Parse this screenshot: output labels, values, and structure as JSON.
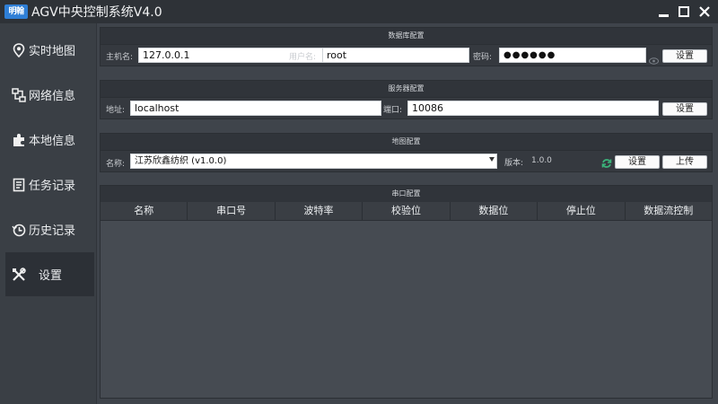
{
  "window": {
    "logo_text": "明翰",
    "title": "AGV中央控制系统V4.0"
  },
  "sidebar": {
    "items": [
      {
        "label": "实时地图",
        "icon": "map-pin-icon"
      },
      {
        "label": "网络信息",
        "icon": "network-icon"
      },
      {
        "label": "本地信息",
        "icon": "puzzle-icon"
      },
      {
        "label": "任务记录",
        "icon": "task-list-icon"
      },
      {
        "label": "历史记录",
        "icon": "history-icon"
      },
      {
        "label": "设置",
        "icon": "wrench-screwdriver-icon",
        "active": true
      }
    ]
  },
  "database": {
    "header": "数据库配置",
    "host_label": "主机名:",
    "host_value": "127.0.0.1",
    "user_label": "用户名:",
    "user_value": "root",
    "password_label": "密码:",
    "password_value": "●●●●●●",
    "set_label": "设置"
  },
  "server": {
    "header": "服务器配置",
    "address_label": "地址:",
    "address_value": "localhost",
    "port_label": "端口:",
    "port_value": "10086",
    "set_label": "设置"
  },
  "map": {
    "header": "地图配置",
    "name_label": "名称:",
    "name_value": "江苏欣鑫纺织 (v1.0.0)",
    "version_label": "版本:",
    "version_value": "1.0.0",
    "set_label": "设置",
    "upload_label": "上传"
  },
  "serial": {
    "header": "串口配置",
    "columns": [
      "名称",
      "串口号",
      "波特率",
      "校验位",
      "数据位",
      "停止位",
      "数据流控制"
    ]
  },
  "colors": {
    "accent_logo": "#2f7fd6",
    "refresh_icon": "#3bb37a",
    "active_nav_bg": "#2c3036"
  }
}
